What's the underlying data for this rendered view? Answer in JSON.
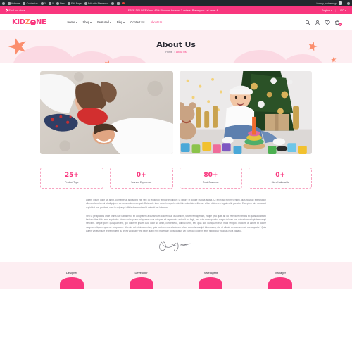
{
  "adminbar": {
    "items": [
      {
        "icon": "wordpress-logo-icon",
        "label": ""
      },
      {
        "icon": "home-icon",
        "label": "Kidzone"
      },
      {
        "icon": "paintbrush-icon",
        "label": "Customize"
      },
      {
        "icon": "refresh-icon",
        "label": "3"
      },
      {
        "icon": "comment-icon",
        "label": "0"
      },
      {
        "icon": "plus-icon",
        "label": "New"
      },
      {
        "icon": "pencil-icon",
        "label": "Edit Page"
      },
      {
        "icon": "elementor-icon",
        "label": "Edit with Elementor"
      },
      {
        "icon": "plugin-icon",
        "label": ""
      },
      {
        "icon": "duplicate-icon",
        "label": ""
      },
      {
        "icon": "record-icon",
        "label": ""
      }
    ],
    "greeting": "Howdy, wpthemego",
    "search_icon": "search-icon"
  },
  "topbar": {
    "store_locator": "Find our store",
    "promo": "FREE DELIVERY and 40% Discount for next 3 orders! Place your 1st order A.",
    "language": "English",
    "currency": "USD",
    "divider": "|"
  },
  "header": {
    "logo": {
      "part1": "KID",
      "part2": "Z",
      "part3": "NE",
      "face_icon": "smiley-face-icon"
    },
    "nav": [
      {
        "label": "Home",
        "has_caret": true,
        "active": false
      },
      {
        "label": "Shop",
        "has_caret": true,
        "active": false
      },
      {
        "label": "Featured",
        "has_caret": true,
        "active": false
      },
      {
        "label": "Blog",
        "has_caret": true,
        "active": false
      },
      {
        "label": "Contact Us",
        "has_caret": false,
        "active": false
      },
      {
        "label": "About Us",
        "has_caret": false,
        "active": true
      }
    ],
    "icons": {
      "search": "search-icon",
      "account": "user-icon",
      "wishlist": "heart-icon",
      "cart": "shopping-bag-icon",
      "cart_count": "0"
    }
  },
  "hero": {
    "title": "About Us",
    "breadcrumb": {
      "home": "Home",
      "separator": "/",
      "current": "About Us"
    }
  },
  "gallery": [
    {
      "alt": "family-lying-on-carpet-photo"
    },
    {
      "alt": "baby-playing-with-toys-christmas-photo"
    }
  ],
  "stats": [
    {
      "value": "25+",
      "label": "Product Type"
    },
    {
      "value": "0+",
      "label": "Years of Experience"
    },
    {
      "value": "80+",
      "label": "Trust Customer"
    },
    {
      "value": "0+",
      "label": "Store Nationwide"
    }
  ],
  "copy": {
    "paragraph1": "Lorem ipsum dolor sit amet, consectetur adipiscing elit, sed do eiusmod tempor incididunt ut labore et dolore magna aliqua. Ut enim ad minim veniam, quis nostrud exercitation ullamco laboris nisi ut aliquip ex ea commodo consequat. Duis aute irure dolor in reprehenderit in voluptate velit esse cillum dolore eu fugiat nulla pariatur. Excepteur sint occaecat cupidatat non proident, sunt in culpa qui officia deserunt mollit anim id est laborum.",
    "paragraph2": "Sed ut perspiciatis unde omnis iste natus error sit voluptatem accusantium doloremque laudantium, totam rem aperiam, eaque ipsa quae ab illo inventore veritatis et quasi architecto beatae vitae dicta sunt explicabo. Nemo enim ipsam voluptatem quia voluptas sit aspernatur aut odit aut fugit, sed quia consequuntur magni dolores eos qui ratione voluptatem sequi nesciunt. Neque porro quisquam est, qui dolorem ipsum quia dolor sit amet, consectetur, adipisci velit, sed quia non numquam eius modi tempora incidunt ut labore et dolore magnam aliquam quaerat voluptatem. Ut enim ad minima veniam, quis nostrum exercitationem ullam corporis suscipit laboriosam, nisi ut aliquid ex ea commodi consequatur? Quis autem vel eum iure reprehenderit qui in ea voluptate velit esse quam nihil molestiae consequatur, vel illum qui dolorem eum fugiat quo voluptas nulla pariatur.",
    "signature_alt": "handwritten-signature"
  },
  "team": [
    {
      "role": "Designer"
    },
    {
      "role": "Developer"
    },
    {
      "role": "Sale Agent"
    },
    {
      "role": "Manager"
    }
  ],
  "colors": {
    "brand_pink": "#f9367e",
    "soft_pink": "#fdeef2",
    "cloud_pink": "#fbd9e3",
    "star_orange": "#fb8e6e",
    "admin_dark": "#23282d",
    "logo_yellow": "#ffc20e",
    "text_dark": "#2a2a33",
    "text_muted": "#7c7c86"
  }
}
